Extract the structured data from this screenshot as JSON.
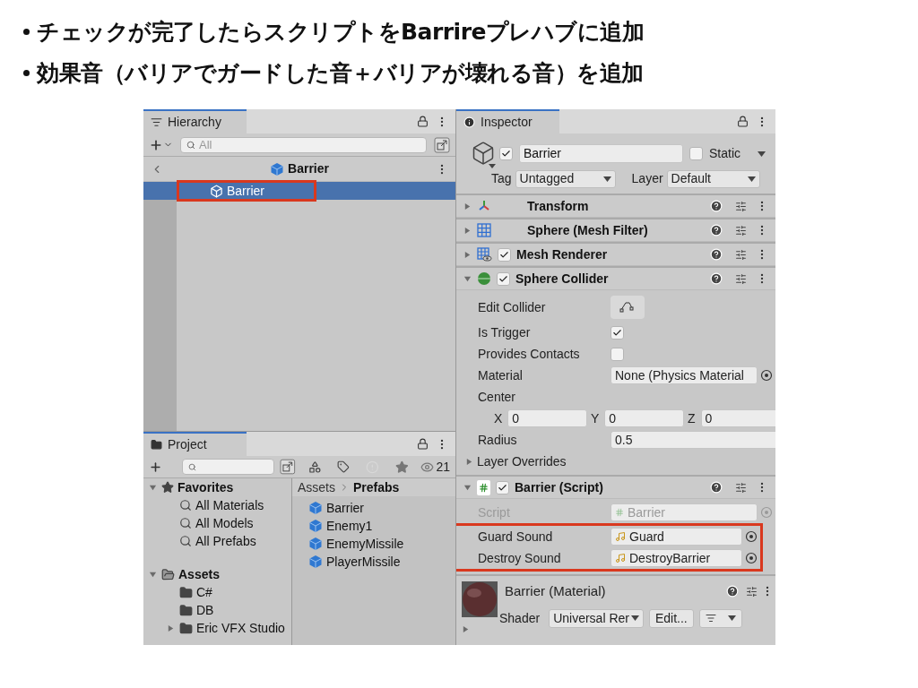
{
  "bullets": [
    {
      "text": "チェックが完了したらスクリプトをBarrireプレハブに追加"
    },
    {
      "text": "効果音（バリアでガードした音＋バリアが壊れる音）を追加"
    }
  ],
  "hierarchy": {
    "tab": "Hierarchy",
    "search_placeholder": "All",
    "scene": "Barrier",
    "items": [
      {
        "label": "Barrier",
        "selected": true,
        "highlighted": true
      }
    ]
  },
  "project": {
    "tab": "Project",
    "hidden_count": "21",
    "tree": [
      {
        "label": "Favorites",
        "kind": "favorites",
        "expanded": true,
        "children": [
          {
            "label": "All Materials",
            "kind": "search"
          },
          {
            "label": "All Models",
            "kind": "search"
          },
          {
            "label": "All Prefabs",
            "kind": "search"
          }
        ]
      },
      {
        "label": "Assets",
        "kind": "folder",
        "expanded": true,
        "children": [
          {
            "label": "C#",
            "kind": "folder"
          },
          {
            "label": "DB",
            "kind": "folder"
          },
          {
            "label": "Eric VFX Studio",
            "kind": "folder",
            "expanded": false
          }
        ]
      }
    ],
    "path": [
      "Assets",
      "Prefabs"
    ],
    "files": [
      {
        "label": "Barrier"
      },
      {
        "label": "Enemy1"
      },
      {
        "label": "EnemyMissile"
      },
      {
        "label": "PlayerMissile"
      }
    ]
  },
  "inspector": {
    "tab": "Inspector",
    "active": true,
    "name": "Barrier",
    "static": false,
    "static_label": "Static",
    "tag_label": "Tag",
    "tag": "Untagged",
    "layer_label": "Layer",
    "layer": "Default",
    "components": [
      {
        "name": "Transform",
        "kind": "transform",
        "expanded": false
      },
      {
        "name": "Sphere (Mesh Filter)",
        "kind": "mesh_filter",
        "expanded": false
      },
      {
        "name": "Mesh Renderer",
        "kind": "mesh_renderer",
        "expanded": false,
        "enabled": true
      },
      {
        "name": "Sphere Collider",
        "kind": "collider",
        "expanded": true,
        "enabled": true,
        "fields": [
          {
            "kind": "edit_button",
            "label": "Edit Collider"
          },
          {
            "kind": "checkbox",
            "label": "Is Trigger",
            "checked": true
          },
          {
            "kind": "checkbox",
            "label": "Provides Contacts",
            "checked": false
          },
          {
            "kind": "object",
            "label": "Material",
            "value": "None (Physics Material"
          },
          {
            "kind": "heading",
            "label": "Center"
          },
          {
            "kind": "vector3",
            "parts": [
              {
                "axis": "X",
                "value": "0"
              },
              {
                "axis": "Y",
                "value": "0"
              },
              {
                "axis": "Z",
                "value": "0"
              }
            ]
          },
          {
            "kind": "text",
            "label": "Radius",
            "value": "0.5"
          },
          {
            "kind": "foldout",
            "label": "Layer Overrides",
            "expanded": false
          }
        ]
      },
      {
        "name": "Barrier (Script)",
        "kind": "script",
        "expanded": true,
        "enabled": true,
        "fields": [
          {
            "kind": "script_ref",
            "label": "Script",
            "value": "Barrier",
            "disabled": true
          },
          {
            "kind": "audio",
            "label": "Guard Sound",
            "value": "Guard",
            "highlighted": true
          },
          {
            "kind": "audio",
            "label": "Destroy Sound",
            "value": "DestroyBarrier",
            "highlighted": true
          }
        ]
      }
    ],
    "material": {
      "name": "Barrier (Material)",
      "shader_label": "Shader",
      "shader": "Universal Rer",
      "edit_button": "Edit..."
    }
  }
}
